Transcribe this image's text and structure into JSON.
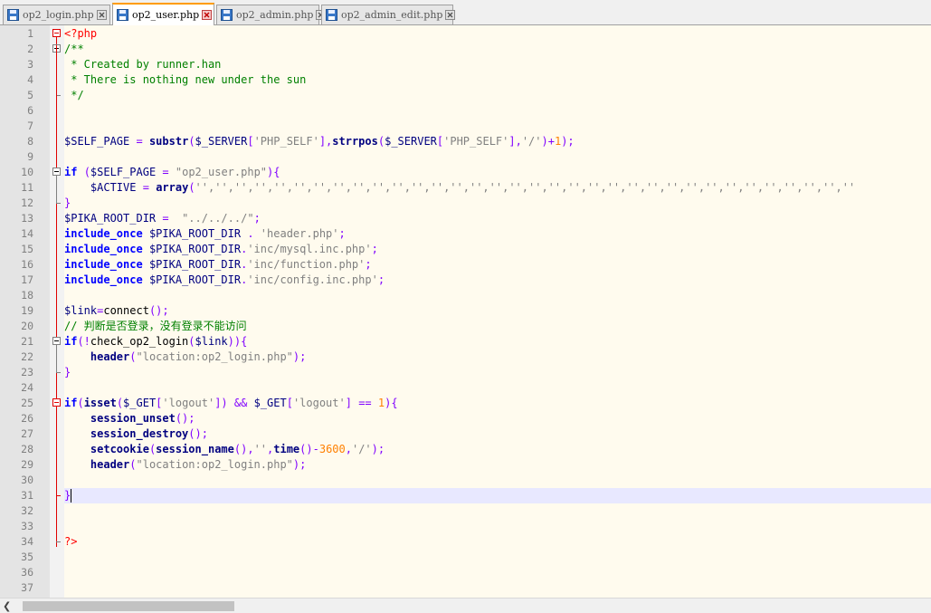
{
  "tabs": [
    {
      "label": "op2_login.php",
      "active": false
    },
    {
      "label": "op2_user.php",
      "active": true
    },
    {
      "label": "op2_admin.php",
      "active": false
    },
    {
      "label": "op2_admin_edit.php",
      "active": false
    }
  ],
  "icons": {
    "save": "save-floppy-icon",
    "close": "close-x-icon",
    "scroll_left": "scroll-left-arrow-icon"
  },
  "colors": {
    "keyword": "#0000ff",
    "function": "#000080",
    "string": "#808080",
    "operator": "#8000ff",
    "number": "#ff8000",
    "comment": "#008000",
    "tag": "#ff0000",
    "background": "#fffbee",
    "current_line": "#e8e8ff",
    "active_tab_accent": "#ff9c00"
  },
  "editor": {
    "current_line": 31,
    "line_numbers": [
      "1",
      "2",
      "3",
      "4",
      "5",
      "6",
      "7",
      "8",
      "9",
      "10",
      "11",
      "12",
      "13",
      "14",
      "15",
      "16",
      "17",
      "18",
      "19",
      "20",
      "21",
      "22",
      "23",
      "24",
      "25",
      "26",
      "27",
      "28",
      "29",
      "30",
      "31",
      "32",
      "33",
      "34",
      "35",
      "36",
      "37"
    ],
    "lines": [
      [
        [
          "t",
          "<?php"
        ]
      ],
      [
        [
          "c",
          "/**"
        ]
      ],
      [
        [
          "c",
          " * Created by runner.han"
        ]
      ],
      [
        [
          "c",
          " * There is nothing new under the sun"
        ]
      ],
      [
        [
          "c",
          " */"
        ]
      ],
      [],
      [],
      [
        [
          "v",
          "$SELF_PAGE"
        ],
        [
          "p",
          " "
        ],
        [
          "o",
          "="
        ],
        [
          "p",
          " "
        ],
        [
          "f",
          "substr"
        ],
        [
          "o",
          "("
        ],
        [
          "v",
          "$_SERVER"
        ],
        [
          "o",
          "["
        ],
        [
          "s",
          "'PHP_SELF'"
        ],
        [
          "o",
          "],"
        ],
        [
          "f",
          "strrpos"
        ],
        [
          "o",
          "("
        ],
        [
          "v",
          "$_SERVER"
        ],
        [
          "o",
          "["
        ],
        [
          "s",
          "'PHP_SELF'"
        ],
        [
          "o",
          "],"
        ],
        [
          "s",
          "'/'"
        ],
        [
          "o",
          ")+"
        ],
        [
          "n",
          "1"
        ],
        [
          "o",
          ");"
        ]
      ],
      [],
      [
        [
          "k",
          "if"
        ],
        [
          "p",
          " "
        ],
        [
          "o",
          "("
        ],
        [
          "v",
          "$SELF_PAGE"
        ],
        [
          "p",
          " "
        ],
        [
          "o",
          "="
        ],
        [
          "p",
          " "
        ],
        [
          "dq",
          "\"op2_user.php\""
        ],
        [
          "o",
          "){"
        ]
      ],
      [
        [
          "p",
          "    "
        ],
        [
          "v",
          "$ACTIVE"
        ],
        [
          "p",
          " "
        ],
        [
          "o",
          "="
        ],
        [
          "p",
          " "
        ],
        [
          "f",
          "array"
        ],
        [
          "o",
          "("
        ],
        [
          "s",
          "'','','','','','','','','','','','','','','','','','','','','','','','','','','','','','','','','',''"
        ]
      ],
      [
        [
          "o",
          "}"
        ]
      ],
      [
        [
          "v",
          "$PIKA_ROOT_DIR"
        ],
        [
          "p",
          " "
        ],
        [
          "o",
          "="
        ],
        [
          "p",
          "  "
        ],
        [
          "dq",
          "\"../../../\""
        ],
        [
          "o",
          ";"
        ]
      ],
      [
        [
          "k",
          "include_once"
        ],
        [
          "p",
          " "
        ],
        [
          "v",
          "$PIKA_ROOT_DIR"
        ],
        [
          "p",
          " "
        ],
        [
          "o",
          "."
        ],
        [
          "p",
          " "
        ],
        [
          "s",
          "'header.php'"
        ],
        [
          "o",
          ";"
        ]
      ],
      [
        [
          "k",
          "include_once"
        ],
        [
          "p",
          " "
        ],
        [
          "v",
          "$PIKA_ROOT_DIR"
        ],
        [
          "o",
          "."
        ],
        [
          "s",
          "'inc/mysql.inc.php'"
        ],
        [
          "o",
          ";"
        ]
      ],
      [
        [
          "k",
          "include_once"
        ],
        [
          "p",
          " "
        ],
        [
          "v",
          "$PIKA_ROOT_DIR"
        ],
        [
          "o",
          "."
        ],
        [
          "s",
          "'inc/function.php'"
        ],
        [
          "o",
          ";"
        ]
      ],
      [
        [
          "k",
          "include_once"
        ],
        [
          "p",
          " "
        ],
        [
          "v",
          "$PIKA_ROOT_DIR"
        ],
        [
          "o",
          "."
        ],
        [
          "s",
          "'inc/config.inc.php'"
        ],
        [
          "o",
          ";"
        ]
      ],
      [],
      [
        [
          "v",
          "$link"
        ],
        [
          "o",
          "="
        ],
        [
          "p",
          "connect"
        ],
        [
          "o",
          "();"
        ]
      ],
      [
        [
          "c",
          "// 判断是否登录，没有登录不能访问"
        ]
      ],
      [
        [
          "k",
          "if"
        ],
        [
          "o",
          "(!"
        ],
        [
          "p",
          "check_op2_login"
        ],
        [
          "o",
          "("
        ],
        [
          "v",
          "$link"
        ],
        [
          "o",
          "))"
        ],
        [
          "o",
          "{"
        ]
      ],
      [
        [
          "p",
          "    "
        ],
        [
          "f",
          "header"
        ],
        [
          "o",
          "("
        ],
        [
          "dq",
          "\"location:op2_login.php\""
        ],
        [
          "o",
          ");"
        ]
      ],
      [
        [
          "o",
          "}"
        ]
      ],
      [],
      [
        [
          "k",
          "if"
        ],
        [
          "o",
          "("
        ],
        [
          "f",
          "isset"
        ],
        [
          "o",
          "("
        ],
        [
          "v",
          "$_GET"
        ],
        [
          "o",
          "["
        ],
        [
          "s",
          "'logout'"
        ],
        [
          "o",
          "])"
        ],
        [
          "p",
          " "
        ],
        [
          "o",
          "&&"
        ],
        [
          "p",
          " "
        ],
        [
          "v",
          "$_GET"
        ],
        [
          "o",
          "["
        ],
        [
          "s",
          "'logout'"
        ],
        [
          "o",
          "]"
        ],
        [
          "p",
          " "
        ],
        [
          "o",
          "=="
        ],
        [
          "p",
          " "
        ],
        [
          "n",
          "1"
        ],
        [
          "o",
          "){"
        ]
      ],
      [
        [
          "p",
          "    "
        ],
        [
          "f",
          "session_unset"
        ],
        [
          "o",
          "();"
        ]
      ],
      [
        [
          "p",
          "    "
        ],
        [
          "f",
          "session_destroy"
        ],
        [
          "o",
          "();"
        ]
      ],
      [
        [
          "p",
          "    "
        ],
        [
          "f",
          "setcookie"
        ],
        [
          "o",
          "("
        ],
        [
          "f",
          "session_name"
        ],
        [
          "o",
          "(),"
        ],
        [
          "s",
          "''"
        ],
        [
          "o",
          ","
        ],
        [
          "f",
          "time"
        ],
        [
          "o",
          "()-"
        ],
        [
          "n",
          "3600"
        ],
        [
          "o",
          ","
        ],
        [
          "s",
          "'/'"
        ],
        [
          "o",
          ");"
        ]
      ],
      [
        [
          "p",
          "    "
        ],
        [
          "f",
          "header"
        ],
        [
          "o",
          "("
        ],
        [
          "dq",
          "\"location:op2_login.php\""
        ],
        [
          "o",
          ");"
        ]
      ],
      [],
      [
        [
          "o",
          "}"
        ]
      ],
      [],
      [],
      [
        [
          "t",
          "?>"
        ]
      ],
      [],
      [],
      []
    ]
  }
}
